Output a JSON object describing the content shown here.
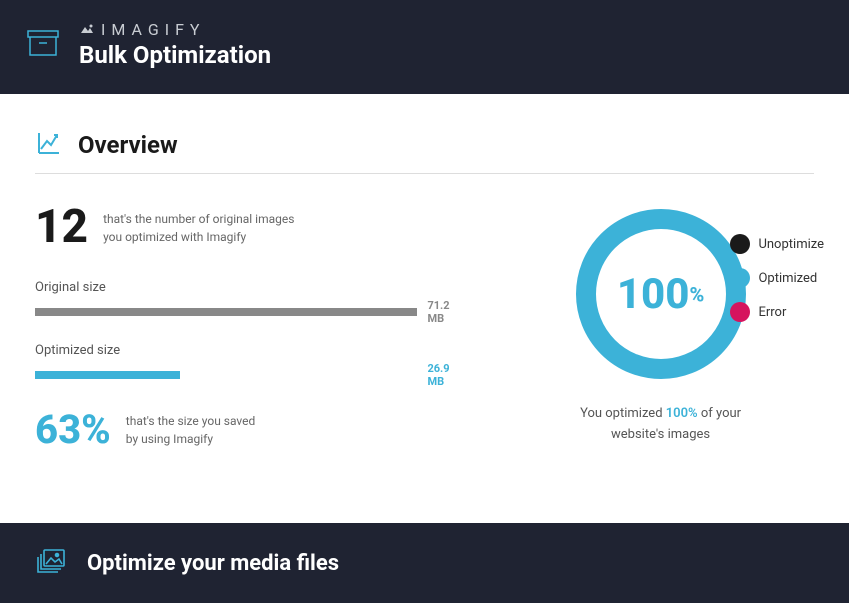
{
  "header": {
    "brand": "IMAGIFY",
    "title": "Bulk Optimization"
  },
  "overview": {
    "section_title": "Overview",
    "count": "12",
    "count_desc_l1": "that's the number of original images",
    "count_desc_l2": "you optimized with Imagify",
    "original_label": "Original size",
    "original_value": "71.2 MB",
    "optimized_label": "Optimized size",
    "optimized_value": "26.9 MB",
    "saving_pct": "63%",
    "saving_desc_l1": "that's the size you saved",
    "saving_desc_l2": "by using Imagify",
    "donut_value": "100",
    "donut_sign": "%",
    "donut_caption_pre": "You optimized ",
    "donut_caption_hl": "100%",
    "donut_caption_post": " of your",
    "donut_caption_l2": "website's images",
    "legend": {
      "unopt": "Unoptimize",
      "opt": "Optimized",
      "err": "Error"
    },
    "colors": {
      "unopt": "#1a1a1a",
      "opt": "#3cb2d8",
      "err": "#d6145e"
    }
  },
  "footer": {
    "title": "Optimize your media files"
  },
  "chart_data": {
    "type": "pie",
    "title": "Image optimization status",
    "series": [
      {
        "name": "Unoptimized",
        "value": 0,
        "color": "#1a1a1a"
      },
      {
        "name": "Optimized",
        "value": 100,
        "color": "#3cb2d8"
      },
      {
        "name": "Error",
        "value": 0,
        "color": "#d6145e"
      }
    ],
    "center_label": "100%"
  }
}
